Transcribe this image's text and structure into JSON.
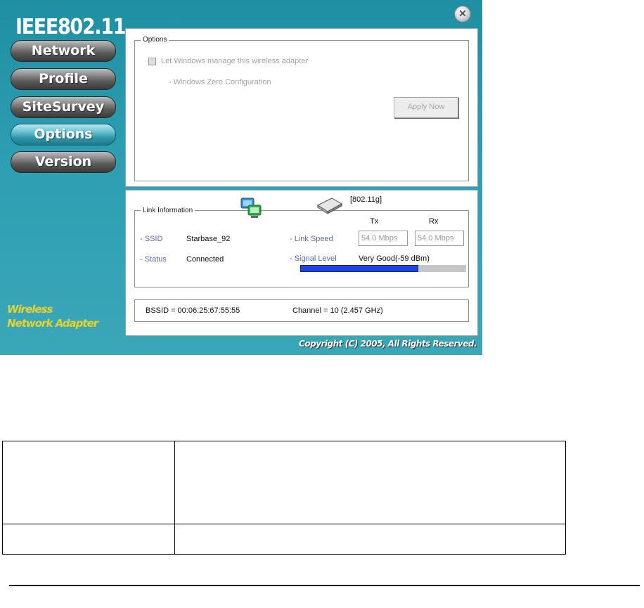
{
  "app": {
    "brand_title": "IEEE802.11",
    "brand_subtitle_line1": "Wireless",
    "brand_subtitle_line2": "Network Adapter",
    "copyright": "Copyright (C) 2005, All Rights Reserved.",
    "accent_color": "#2c9fb3",
    "brand_subtitle_color": "#e8d12a"
  },
  "nav": {
    "items": [
      {
        "label": "Network"
      },
      {
        "label": "Profile"
      },
      {
        "label": "SiteSurvey"
      },
      {
        "label": "Options",
        "active": true
      },
      {
        "label": "Version"
      }
    ]
  },
  "options": {
    "group_label": "Options",
    "checkbox_label": "Let Windows manage this wireless adapter",
    "checkbox_checked": false,
    "sub_label": "- Windows Zero Configuration",
    "apply_label": "Apply Now"
  },
  "link_info": {
    "group_label": "Link Information",
    "mode": "[802.11g]",
    "ssid_label": "- SSID",
    "ssid_value": "Starbase_92",
    "status_label": "- Status",
    "status_value": "Connected",
    "link_speed_label": "- Link Speed",
    "tx_label": "Tx",
    "rx_label": "Rx",
    "tx_value": "54.0 Mbps",
    "rx_value": "54.0 Mbps",
    "signal_label": "- Signal Level",
    "signal_value": "Very Good(-59 dBm)",
    "signal_fraction": 0.71,
    "icons": [
      "network-computers-icon",
      "wireless-adapter-icon"
    ]
  },
  "bssid_bar": {
    "bssid": "BSSID = 00:06:25:67:55:55",
    "channel": "Channel = 10 (2.457 GHz)"
  }
}
